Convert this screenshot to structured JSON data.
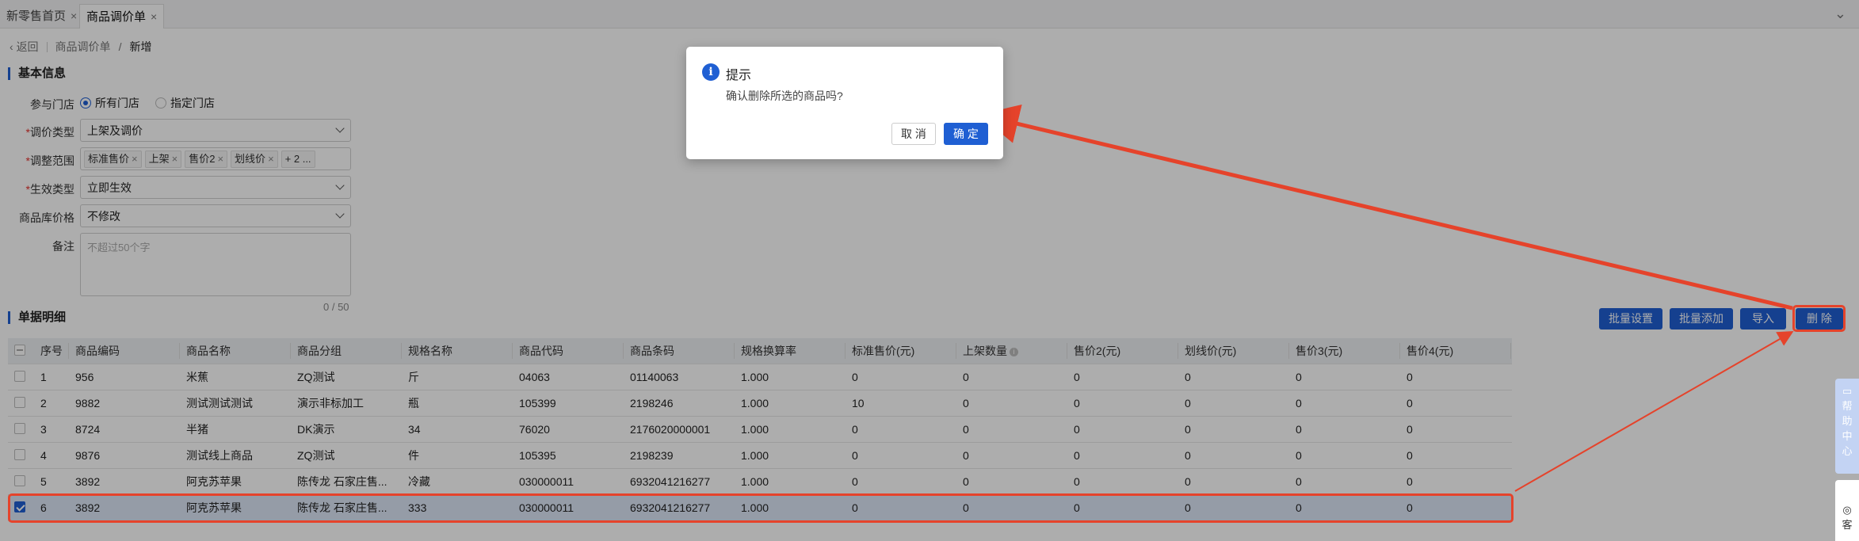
{
  "tabs": [
    {
      "label": "新零售首页",
      "close": "×"
    },
    {
      "label": "商品调价单",
      "close": "×"
    }
  ],
  "breadcrumb": {
    "back": "返回",
    "parent": "商品调价单",
    "separator": "/",
    "current": "新增"
  },
  "basic_info": {
    "title": "基本信息",
    "store_label": "参与门店",
    "store_options": [
      "所有门店",
      "指定门店"
    ],
    "price_type_label": "调价类型",
    "price_type_value": "上架及调价",
    "scope_label": "调整范围",
    "scope_tags": [
      "标准售价",
      "上架",
      "售价2",
      "划线价"
    ],
    "scope_more": "+ 2 ...",
    "effect_label": "生效类型",
    "effect_value": "立即生效",
    "stock_price_label": "商品库价格",
    "stock_price_value": "不修改",
    "remark_label": "备注",
    "remark_placeholder": "不超过50个字",
    "remark_counter": "0 / 50",
    "required_mark": "*"
  },
  "detail": {
    "title": "单据明细",
    "buttons": {
      "batch_set": "批量设置",
      "batch_add": "批量添加",
      "import": "导入",
      "delete": "删 除"
    },
    "columns": [
      "序号",
      "商品编码",
      "商品名称",
      "商品分组",
      "规格名称",
      "商品代码",
      "商品条码",
      "规格换算率",
      "标准售价(元)",
      "上架数量",
      "售价2(元)",
      "划线价(元)",
      "售价3(元)",
      "售价4(元)"
    ],
    "rows": [
      [
        "1",
        "956",
        "米蕉",
        "ZQ测试",
        "斤",
        "04063",
        "01140063",
        "1.000",
        "0",
        "0",
        "0",
        "0",
        "0",
        "0"
      ],
      [
        "2",
        "9882",
        "测试测试测试",
        "演示非标加工",
        "瓶",
        "105399",
        "2198246",
        "1.000",
        "10",
        "0",
        "0",
        "0",
        "0",
        "0"
      ],
      [
        "3",
        "8724",
        "半猪",
        "DK演示",
        "34",
        "76020",
        "2176020000001",
        "1.000",
        "0",
        "0",
        "0",
        "0",
        "0",
        "0"
      ],
      [
        "4",
        "9876",
        "测试线上商品",
        "ZQ测试",
        "件",
        "105395",
        "2198239",
        "1.000",
        "0",
        "0",
        "0",
        "0",
        "0",
        "0"
      ],
      [
        "5",
        "3892",
        "阿克苏苹果",
        "陈传龙 石家庄售...",
        "冷藏",
        "030000011",
        "6932041216277",
        "1.000",
        "0",
        "0",
        "0",
        "0",
        "0",
        "0"
      ],
      [
        "6",
        "3892",
        "阿克苏苹果",
        "陈传龙 石家庄售...",
        "333",
        "030000011",
        "6932041216277",
        "1.000",
        "0",
        "0",
        "0",
        "0",
        "0",
        "0"
      ]
    ],
    "selected_row": 6
  },
  "dialog": {
    "title": "提示",
    "message": "确认删除所选的商品吗?",
    "cancel": "取 消",
    "ok": "确 定",
    "icon": "info-icon"
  },
  "helper": {
    "label": "帮助中心",
    "service": "客"
  },
  "colors": {
    "primary": "#1f5fd3",
    "highlight": "#e5432b",
    "required": "#e5322d"
  }
}
